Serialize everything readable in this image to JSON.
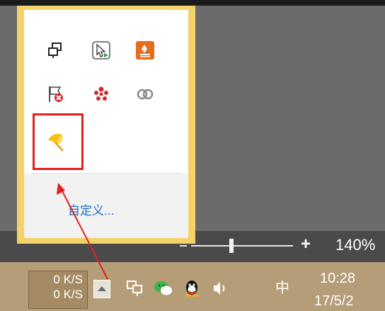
{
  "flyout": {
    "icons": [
      {
        "name": "display-switch-icon"
      },
      {
        "name": "cursor-play-icon"
      },
      {
        "name": "app-orange-icon"
      },
      {
        "name": "flag-error-icon"
      },
      {
        "name": "red-dots-icon"
      },
      {
        "name": "infinity-link-icon"
      },
      {
        "name": "yellow-umbrella-icon"
      }
    ],
    "customize_label": "自定义..."
  },
  "zoom": {
    "plus_label": "+",
    "level": "140%"
  },
  "taskbar": {
    "net_up": "0 K/S",
    "net_down": "0 K/S",
    "ime_label": "中",
    "clock_time": "10:28",
    "clock_date": "17/5/2"
  },
  "colors": {
    "flyout_border": "#f3d26a",
    "taskbar": "#b49d77",
    "highlight": "#e0221b",
    "link": "#1c6bc7"
  }
}
